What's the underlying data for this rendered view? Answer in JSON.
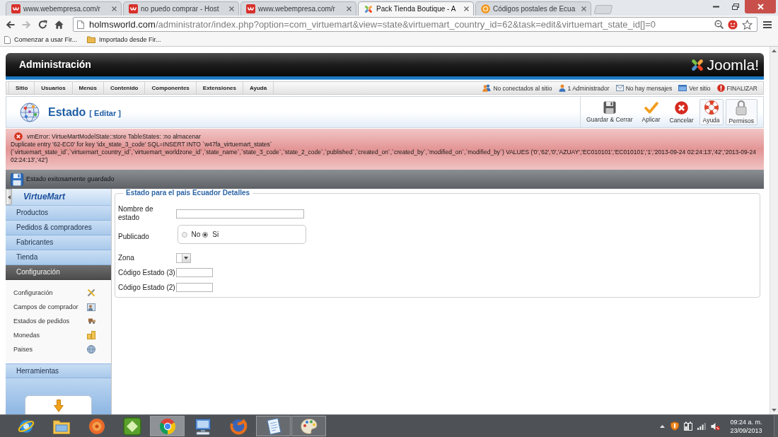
{
  "browser": {
    "tabs": [
      {
        "title": "www.webempresa.com/r",
        "kind": "tile",
        "selected": false
      },
      {
        "title": "no puedo comprar - Host",
        "kind": "tile",
        "selected": false
      },
      {
        "title": "www.webempresa.com/r",
        "kind": "tile",
        "selected": false
      },
      {
        "title": "Pack Tienda Boutique - A",
        "kind": "pinwheel",
        "selected": true
      },
      {
        "title": "Códigos postales de Ecua",
        "kind": "ring",
        "selected": false
      }
    ],
    "address": {
      "host": "holmsworld.com",
      "path": "/administrator/index.php?option=com_virtuemart&view=state&virtuemart_country_id=62&task=edit&virtuemart_state_id[]=0"
    },
    "bookmarks": [
      {
        "label": "Comenzar a usar Fir...",
        "kind": "page"
      },
      {
        "label": "Importado desde Fir...",
        "kind": "folder"
      }
    ]
  },
  "header": {
    "title": "Administración",
    "logo_text": "Joomla!"
  },
  "menu": {
    "items": [
      "Sitio",
      "Usuarios",
      "Menús",
      "Contenido",
      "Componentes",
      "Extensiones",
      "Ayuda"
    ],
    "status": [
      {
        "label": "No conectados al sitio",
        "kind": "users"
      },
      {
        "label": "1 Administrador",
        "kind": "user"
      },
      {
        "label": "No hay mensajes",
        "kind": "messages"
      },
      {
        "label": "Ver sitio",
        "kind": "site"
      },
      {
        "label": "FINALIZAR",
        "kind": "logout"
      }
    ]
  },
  "toolbar": {
    "title": "Estado",
    "subtitle": "[ Editar ]",
    "buttons": [
      {
        "label": "Guardar & Cerrar",
        "kind": "save",
        "framed": false
      },
      {
        "label": "Aplicar",
        "kind": "apply",
        "framed": false
      },
      {
        "label": "Cancelar",
        "kind": "cancel",
        "framed": false
      },
      {
        "label": "Ayuda",
        "kind": "help",
        "framed": true
      },
      {
        "label": "Permisos",
        "kind": "permissions",
        "framed": true
      }
    ]
  },
  "error": {
    "title": "vmError: VirtueMartModelState::store TableStates: :no almacenar",
    "detail": "Duplicate entry '62-EC0' for key 'idx_state_3_code' SQL=INSERT INTO `w47fa_virtuemart_states` (`virtuemart_state_id`,`virtuemart_country_id`,`virtuemart_worldzone_id`,`state_name`,`state_3_code`,`state_2_code`,`published`,`created_on`,`created_by`,`modified_on`,`modified_by`) VALUES ('0','62','0','AZUAY','EC010101','EC010101','1','2013-09-24 02:24:13','42','2013-09-24 02:24:13','42')"
  },
  "message": "Estado exitosamente guardado",
  "sidebar": {
    "logo_text": "VirtueMart",
    "sections": [
      {
        "label": "Productos",
        "expanded": false
      },
      {
        "label": "Pedidos & compradores",
        "expanded": false
      },
      {
        "label": "Fabricantes",
        "expanded": false
      },
      {
        "label": "Tienda",
        "expanded": false
      },
      {
        "label": "Configuración",
        "expanded": true,
        "children": [
          {
            "label": "Configuración",
            "kind": "tools"
          },
          {
            "label": "Campos de comprador",
            "kind": "card"
          },
          {
            "label": "Estados de pedidos",
            "kind": "truck"
          },
          {
            "label": "Monedas",
            "kind": "coins"
          },
          {
            "label": "Paises",
            "kind": "globe"
          }
        ]
      },
      {
        "label": "Herramientas",
        "expanded": false
      }
    ]
  },
  "form": {
    "legend": "Estado para el pais Ecuador Detalles",
    "fields": [
      {
        "label": "Nombre de estado",
        "kind": "text"
      },
      {
        "label": "Publicado",
        "kind": "radio",
        "options": [
          {
            "label": "No",
            "selected": false
          },
          {
            "label": "Si",
            "selected": true
          }
        ]
      },
      {
        "label": "Zona",
        "kind": "select"
      },
      {
        "label": "Código Estado (3)",
        "kind": "code"
      },
      {
        "label": "Código Estado (2)",
        "kind": "code"
      }
    ]
  },
  "taskbar": {
    "apps": [
      {
        "kind": "ie",
        "running": false,
        "selected": false
      },
      {
        "kind": "folder",
        "running": false,
        "selected": false
      },
      {
        "kind": "target",
        "running": false,
        "selected": false
      },
      {
        "kind": "tile",
        "running": false,
        "selected": false
      },
      {
        "kind": "wheel",
        "running": true,
        "selected": true
      },
      {
        "kind": "monitor",
        "running": false,
        "selected": false
      },
      {
        "kind": "swirl",
        "running": false,
        "selected": false
      },
      {
        "kind": "notebook",
        "running": true,
        "selected": false
      },
      {
        "kind": "palette",
        "running": true,
        "selected": false
      }
    ],
    "clock": {
      "time": "09:24 a. m.",
      "date": "23/09/2013"
    }
  }
}
